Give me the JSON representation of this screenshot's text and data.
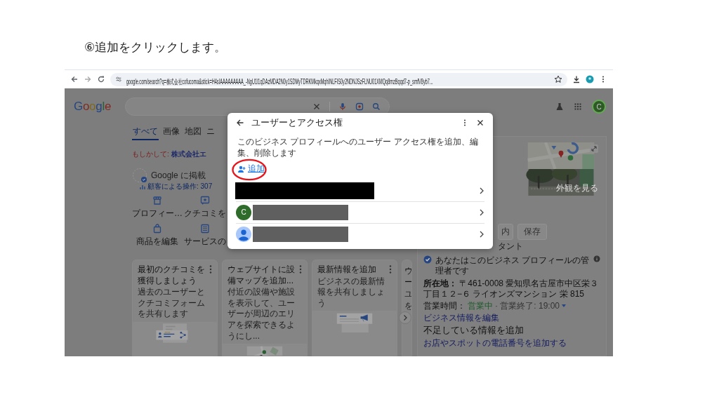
{
  "instruction": "⑥追加をクリックします。",
  "browser": {
    "url": "google.com/search?q=株式会社cofucoma&stick=H4sIAAAAAAAAA_-NgU1l1qDAzMDA2N0y1SDMyTDRKMkqxMqhINLFIS0y2NDNJSzFLNU01XMQq8mzBqqd7-p_smfV8yb7..."
  },
  "search_page": {
    "logo": "Google",
    "account_initial": "C",
    "tabs": [
      {
        "label": "すべて",
        "selected": true
      },
      {
        "label": "画像",
        "selected": false
      },
      {
        "label": "地図",
        "selected": false
      },
      {
        "label": "ニ",
        "selected": false
      }
    ],
    "did_you_mean": {
      "prefix": "もしかして:",
      "suggestion": "株式会社エ"
    },
    "profile": {
      "title": "Google に掲載",
      "stats": "顧客による操作: 307"
    },
    "actions": [
      {
        "label": "プロフィー…"
      },
      {
        "label": "クチコミを"
      },
      {
        "label": "商品を編集"
      },
      {
        "label": "サービスの"
      }
    ],
    "cards": [
      {
        "title": "最初のクチコミを獲得しましょう",
        "description": "過去のユーザーとクチコミフォームを共有します",
        "partial": false
      },
      {
        "title": "ウェブサイトに設備マップを追加...",
        "description": "付近の設備や施設を表示して、ユーザーが周辺のエリアを探索できるようにし...",
        "partial": false
      },
      {
        "title": "最新情報を追加",
        "description": "ビジネスの最新情報を共有しましょう",
        "partial": false
      },
      {
        "title": "ウー",
        "description": "ユを",
        "partial": true
      }
    ],
    "knowledge_panel": {
      "photo_label": "外観を見る",
      "buttons": [
        "内",
        "保存"
      ],
      "note": "タント",
      "owner_note": "あなたはこのビジネス プロフィールの管理者です",
      "address": {
        "label": "所在地：",
        "value": "〒461-0008 愛知県名古屋市中区栄３丁目１２−６ ライオンズマンション 栄 815"
      },
      "hours": {
        "label": "営業時間：",
        "status": "営業中",
        "closing": "· 営業終了: 19:00"
      },
      "edit_link": "ビジネス情報を編集",
      "missing_heading": "不足している情報を追加",
      "missing_link": "お店やスポットの電話番号を追加する"
    }
  },
  "dialog": {
    "title": "ユーザーとアクセス権",
    "description": "このビジネス プロフィールへのユーザー アクセス権を追加、編集、削除します",
    "add_label": "追加",
    "users": [
      {
        "kind": "plain"
      },
      {
        "kind": "initial",
        "initial": "C"
      },
      {
        "kind": "silhouette"
      }
    ]
  }
}
